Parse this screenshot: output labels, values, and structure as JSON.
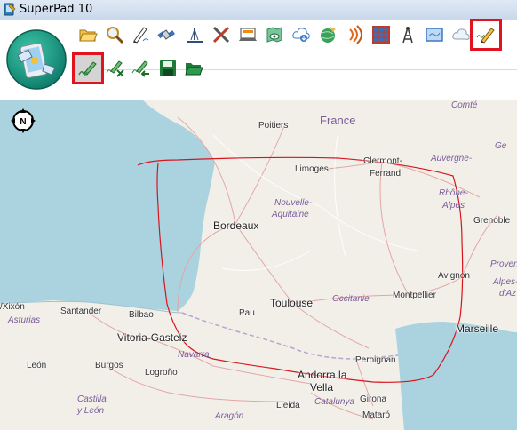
{
  "window": {
    "title": "SuperPad 10"
  },
  "toolbar": {
    "row1": [
      {
        "name": "open-folder-icon",
        "color": "#f1b53a"
      },
      {
        "name": "search-map-icon",
        "color": "#c48a24"
      },
      {
        "name": "pen-line-icon",
        "color": "#333333"
      },
      {
        "name": "satellite-icon",
        "color": "#3b6fb6"
      },
      {
        "name": "measure-icon",
        "color": "#2f4d7a"
      },
      {
        "name": "cross-tools-icon",
        "color": "#c03b2a"
      },
      {
        "name": "laptop-icon",
        "color": "#ef8a1a"
      },
      {
        "name": "map-view-icon",
        "color": "#2f8c58"
      },
      {
        "name": "cloud-download-icon",
        "color": "#3a7cc4"
      },
      {
        "name": "globe-sync-icon",
        "color": "#3aa15a"
      },
      {
        "name": "signal-icon",
        "color": "#e06a1a"
      },
      {
        "name": "grid-icon",
        "color": "#c0392b"
      },
      {
        "name": "tower-icon",
        "color": "#3a3a3a"
      },
      {
        "name": "map-frame-icon",
        "color": "#3b79c2"
      },
      {
        "name": "cloud-icon",
        "color": "#8aa0b8"
      },
      {
        "name": "draw-pencil-icon",
        "color": "#e0a21a"
      }
    ],
    "row2": [
      {
        "name": "sketch-pen-icon",
        "color": "#2e8b3a"
      },
      {
        "name": "erase-sketch-icon",
        "color": "#2e8b3a"
      },
      {
        "name": "undo-sketch-icon",
        "color": "#2e8b3a"
      },
      {
        "name": "save-icon",
        "color": "#1f7a3a"
      },
      {
        "name": "open-folder-green-icon",
        "color": "#1f7a3a"
      }
    ]
  },
  "map": {
    "compass_label": "N",
    "country": "France",
    "regions": [
      "Nouvelle-",
      "Aquitaine",
      "Occitanie",
      "Auvergne-",
      "Rhône-",
      "Alpes",
      "Provence-",
      "Alpes-",
      "d'Az",
      "Comté",
      "Navarra",
      "Castilla",
      "y León",
      "Aragón",
      "Catalunya",
      "Asturias",
      "Ge"
    ],
    "cities": [
      "Bordeaux",
      "Toulouse",
      "Vitoria-Gasteiz",
      "Marseille",
      "Andorra la",
      "Vella"
    ],
    "towns": [
      "Poitiers",
      "Limoges",
      "Clermont-",
      "Ferrand",
      "Grenoble",
      "Montpellier",
      "Avignon",
      "Perpignan",
      "Pau",
      "Santander",
      "Bilbao",
      "Burgos",
      "Logroño",
      "León",
      "Girona",
      "Lleida",
      "Mataró",
      "/Xixón"
    ],
    "colors": {
      "sea": "#aad3df",
      "land": "#f2efe9",
      "sketch": "#d8141c",
      "border": "#b9a3cf",
      "highlight": "#e0141e"
    }
  }
}
